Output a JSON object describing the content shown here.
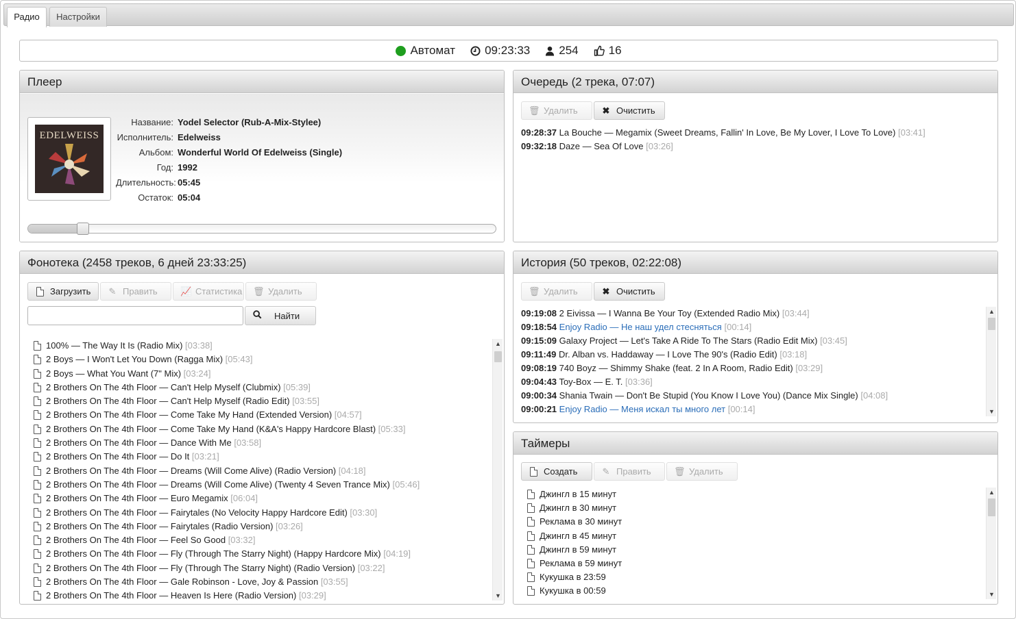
{
  "tabs": [
    {
      "label": "Радио",
      "active": true
    },
    {
      "label": "Настройки",
      "active": false
    }
  ],
  "status": {
    "mode": "Автомат",
    "mode_color": "#1e9e1e",
    "time": "09:23:33",
    "listeners": "254",
    "likes": "16"
  },
  "player": {
    "title": "Плеер",
    "cover_text": "EDELWEISS",
    "labels": {
      "name": "Название:",
      "artist": "Исполнитель:",
      "album": "Альбом:",
      "year": "Год:",
      "duration": "Длительность:",
      "remaining": "Остаток:"
    },
    "values": {
      "name": "Yodel Selector (Rub-A-Mix-Stylee)",
      "artist": "Edelweiss",
      "album": "Wonderful World Of Edelweiss (Single)",
      "year": "1992",
      "duration": "05:45",
      "remaining": "05:04"
    },
    "progress_fraction": 0.118
  },
  "queue": {
    "title": "Очередь (2 трека, 07:07)",
    "buttons": {
      "delete": "Удалить",
      "clear": "Очистить"
    },
    "items": [
      {
        "time": "09:28:37",
        "track": "La Bouche — Megamix (Sweet Dreams, Fallin' In Love, Be My Lover, I Love To Love)",
        "dur": "[03:41]"
      },
      {
        "time": "09:32:18",
        "track": "Daze — Sea Of Love",
        "dur": "[03:26]"
      }
    ]
  },
  "library": {
    "title": "Фонотека (2458 треков, 6 дней 23:33:25)",
    "buttons": {
      "upload": "Загрузить",
      "edit": "Править",
      "stats": "Статистика",
      "delete": "Удалить",
      "search": "Найти"
    },
    "search_value": "",
    "items": [
      {
        "track": "100% — The Way It Is (Radio Mix)",
        "dur": "[03:38]"
      },
      {
        "track": "2 Boys — I Won't Let You Down (Ragga Mix)",
        "dur": "[05:43]"
      },
      {
        "track": "2 Boys — What You Want (7\" Mix)",
        "dur": "[03:24]"
      },
      {
        "track": "2 Brothers On The 4th Floor — Can't Help Myself (Clubmix)",
        "dur": "[05:39]"
      },
      {
        "track": "2 Brothers On The 4th Floor — Can't Help Myself (Radio Edit)",
        "dur": "[03:55]"
      },
      {
        "track": "2 Brothers On The 4th Floor — Come Take My Hand (Extended Version)",
        "dur": "[04:57]"
      },
      {
        "track": "2 Brothers On The 4th Floor — Come Take My Hand (K&A's Happy Hardcore Blast)",
        "dur": "[05:33]"
      },
      {
        "track": "2 Brothers On The 4th Floor — Dance With Me",
        "dur": "[03:58]"
      },
      {
        "track": "2 Brothers On The 4th Floor — Do It",
        "dur": "[03:21]"
      },
      {
        "track": "2 Brothers On The 4th Floor — Dreams (Will Come Alive) (Radio Version)",
        "dur": "[04:18]"
      },
      {
        "track": "2 Brothers On The 4th Floor — Dreams (Will Come Alive) (Twenty 4 Seven Trance Mix)",
        "dur": "[05:46]"
      },
      {
        "track": "2 Brothers On The 4th Floor — Euro Megamix",
        "dur": "[06:04]"
      },
      {
        "track": "2 Brothers On The 4th Floor — Fairytales (No Velocity Happy Hardcore Edit)",
        "dur": "[03:30]"
      },
      {
        "track": "2 Brothers On The 4th Floor — Fairytales (Radio Version)",
        "dur": "[03:26]"
      },
      {
        "track": "2 Brothers On The 4th Floor — Feel So Good",
        "dur": "[03:32]"
      },
      {
        "track": "2 Brothers On The 4th Floor — Fly (Through The Starry Night) (Happy Hardcore Mix)",
        "dur": "[04:19]"
      },
      {
        "track": "2 Brothers On The 4th Floor — Fly (Through The Starry Night) (Radio Version)",
        "dur": "[03:22]"
      },
      {
        "track": "2 Brothers On The 4th Floor — Gale Robinson - Love, Joy & Passion",
        "dur": "[03:55]"
      },
      {
        "track": "2 Brothers On The 4th Floor — Heaven Is Here (Radio Version)",
        "dur": "[03:29]"
      }
    ]
  },
  "history": {
    "title": "История (50 треков, 02:22:08)",
    "buttons": {
      "delete": "Удалить",
      "clear": "Очистить"
    },
    "items": [
      {
        "time": "09:19:08",
        "track": "2 Eivissa — I Wanna Be Your Toy (Extended Radio Mix)",
        "dur": "[03:44]",
        "jingle": false
      },
      {
        "time": "09:18:54",
        "track": "Enjoy Radio — Не наш удел стесняться",
        "dur": "[00:14]",
        "jingle": true
      },
      {
        "time": "09:15:09",
        "track": "Galaxy Project — Let's Take A Ride To The Stars (Radio Edit Mix)",
        "dur": "[03:45]",
        "jingle": false
      },
      {
        "time": "09:11:49",
        "track": "Dr. Alban vs. Haddaway — I Love The 90's (Radio Edit)",
        "dur": "[03:18]",
        "jingle": false
      },
      {
        "time": "09:08:19",
        "track": "740 Boyz — Shimmy Shake (feat. 2 In A Room, Radio Edit)",
        "dur": "[03:29]",
        "jingle": false
      },
      {
        "time": "09:04:43",
        "track": "Toy-Box — E. T.",
        "dur": "[03:36]",
        "jingle": false
      },
      {
        "time": "09:00:34",
        "track": "Shania Twain — Don't Be Stupid (You Know I Love You) (Dance Mix Single)",
        "dur": "[04:08]",
        "jingle": false
      },
      {
        "time": "09:00:21",
        "track": "Enjoy Radio — Меня искал ты много лет",
        "dur": "[00:14]",
        "jingle": true
      }
    ]
  },
  "timers": {
    "title": "Таймеры",
    "buttons": {
      "create": "Создать",
      "edit": "Править",
      "delete": "Удалить"
    },
    "items": [
      "Джингл в 15 минут",
      "Джингл в 30 минут",
      "Реклама в 30 минут",
      "Джингл в 45 минут",
      "Джингл в 59 минут",
      "Реклама в 59 минут",
      "Кукушка в 23:59",
      "Кукушка в 00:59"
    ]
  }
}
